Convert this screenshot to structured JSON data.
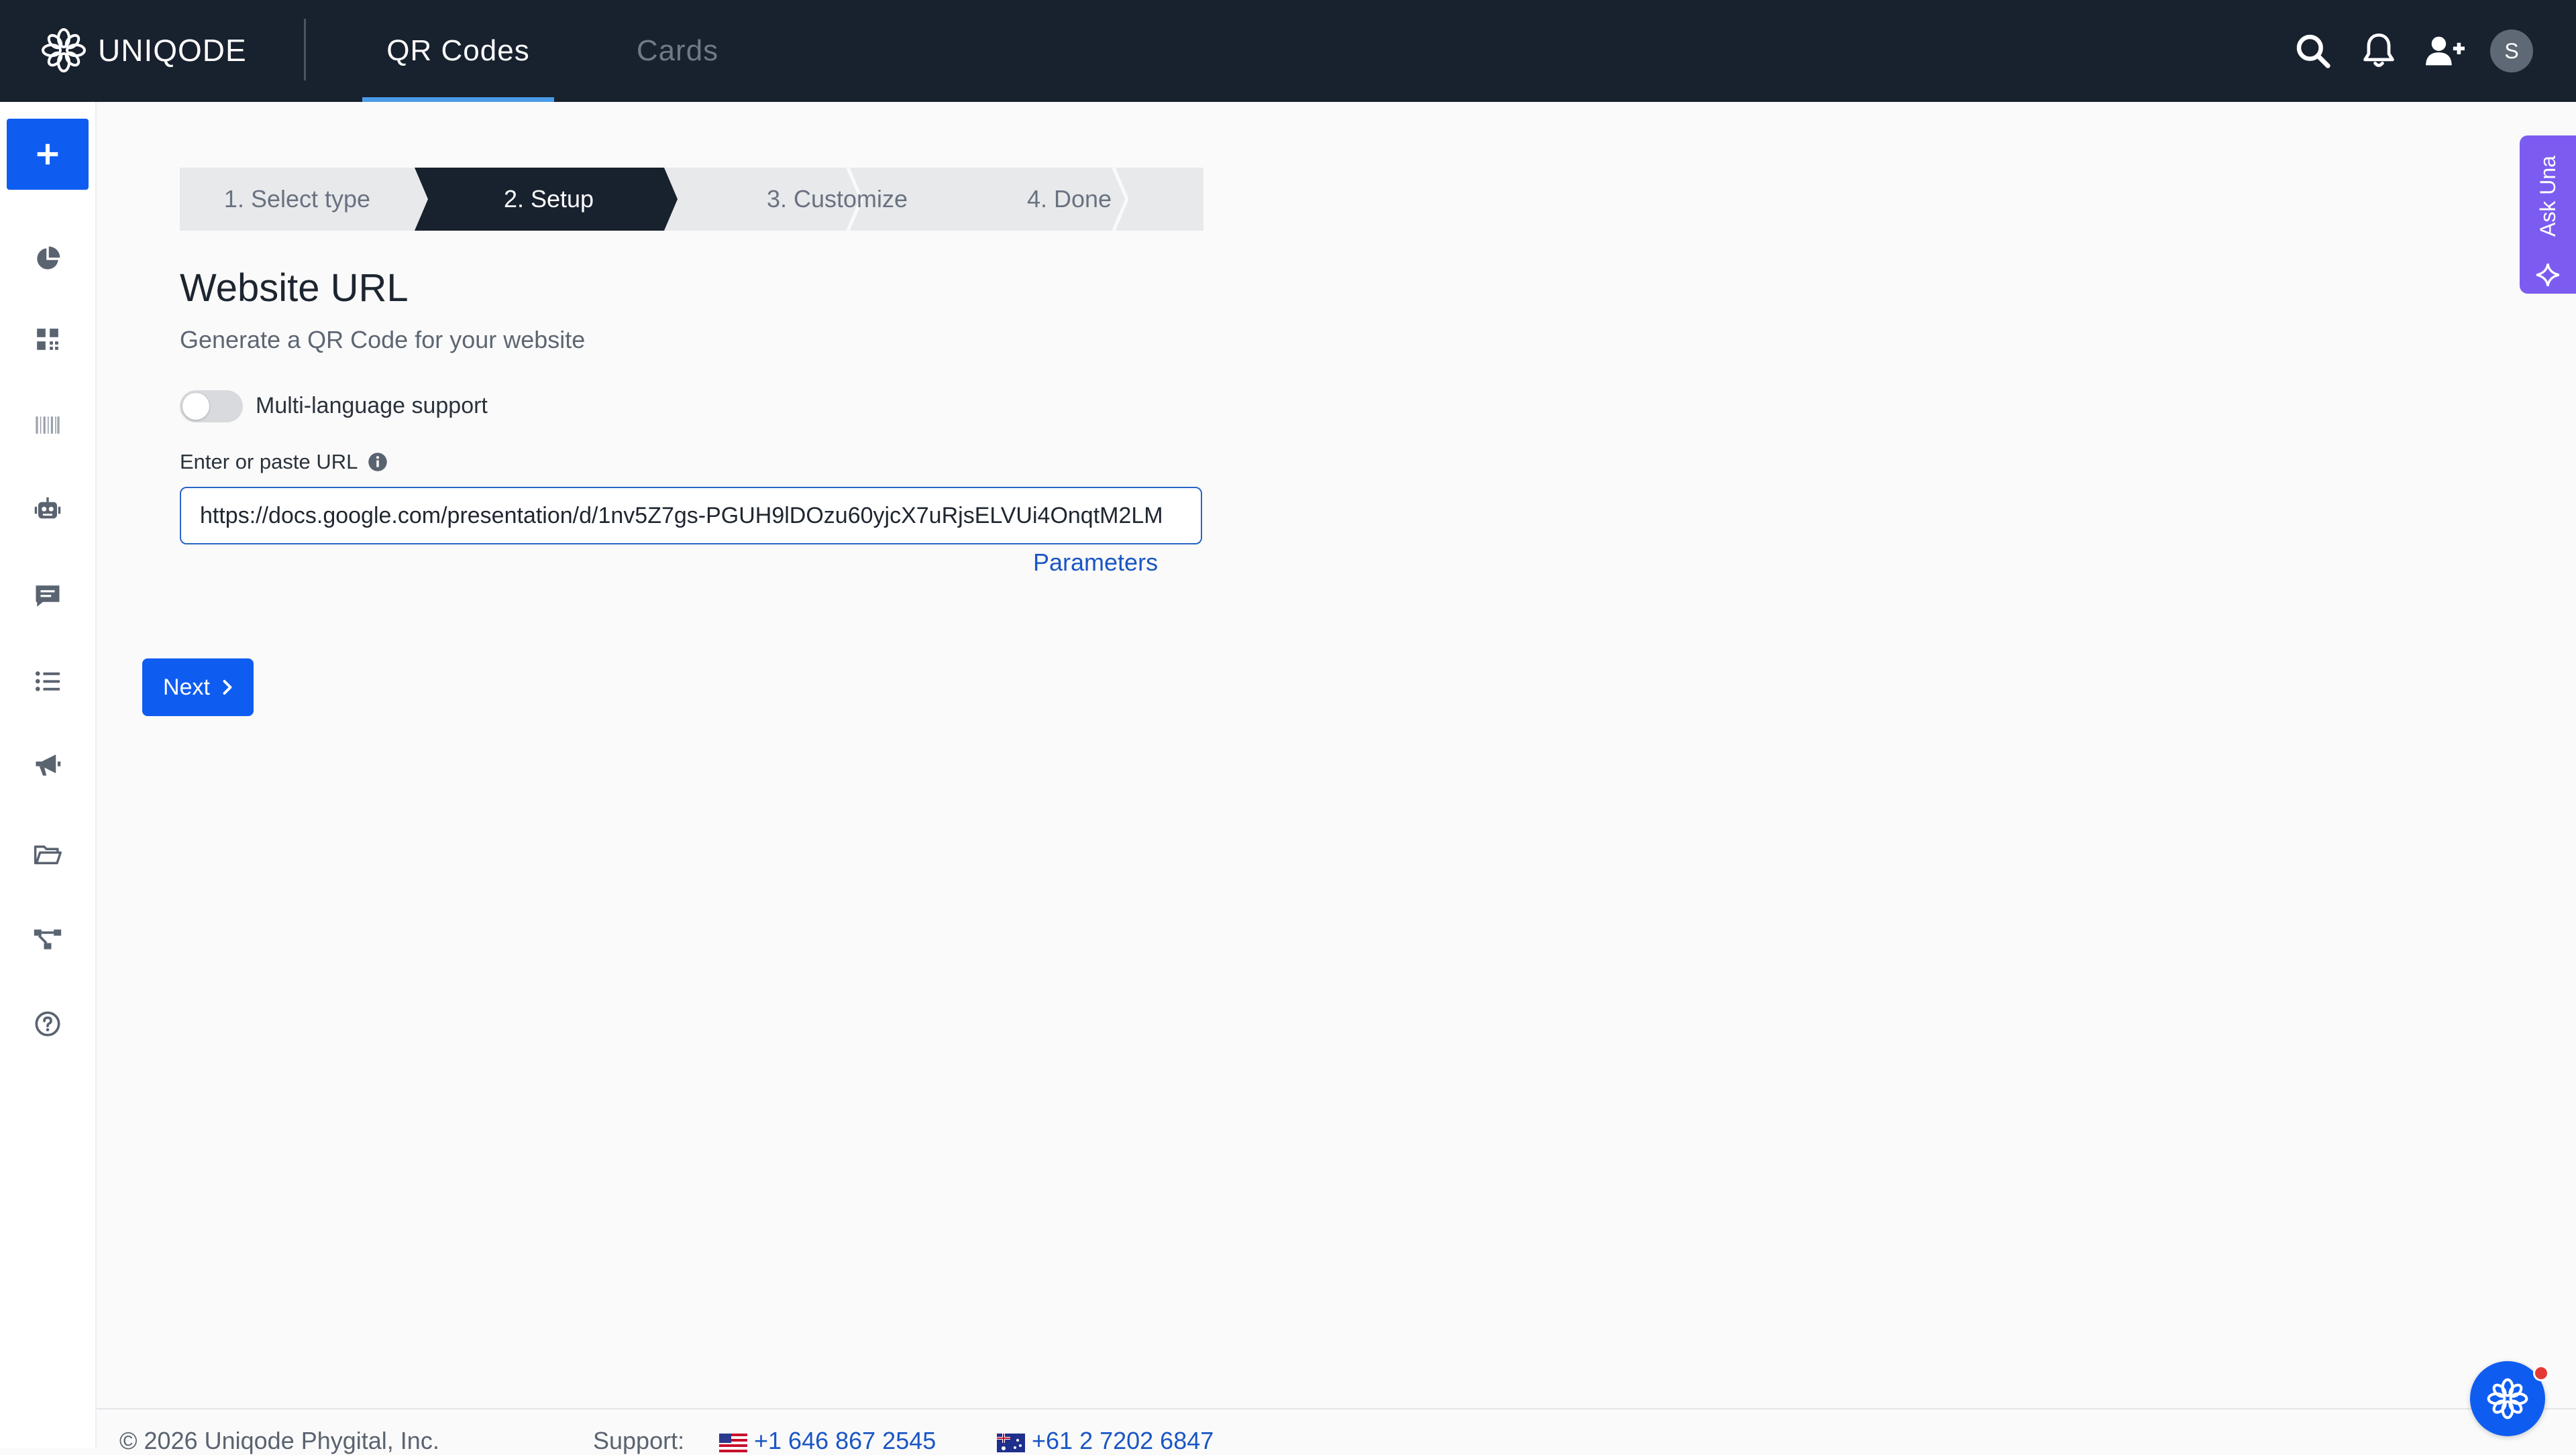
{
  "brand": {
    "name": "UNIQODE"
  },
  "nav": {
    "tabs": [
      {
        "label": "QR Codes",
        "active": true
      },
      {
        "label": "Cards",
        "active": false
      }
    ]
  },
  "topbar_icons": [
    "search-icon",
    "bell-icon",
    "add-user-icon"
  ],
  "user": {
    "initial": "S"
  },
  "sidebar": {
    "items": [
      {
        "icon": "plus-icon",
        "name": "create"
      },
      {
        "icon": "pie-chart-icon",
        "name": "analytics"
      },
      {
        "icon": "qr-code-icon",
        "name": "qr-codes"
      },
      {
        "icon": "barcode-icon",
        "name": "barcodes"
      },
      {
        "icon": "robot-icon",
        "name": "automation"
      },
      {
        "icon": "message-icon",
        "name": "messages"
      },
      {
        "icon": "list-icon",
        "name": "lists"
      },
      {
        "icon": "megaphone-icon",
        "name": "campaigns"
      },
      {
        "icon": "folder-icon",
        "name": "folders"
      },
      {
        "icon": "hierarchy-icon",
        "name": "hierarchy"
      },
      {
        "icon": "help-icon",
        "name": "help"
      }
    ]
  },
  "stepper": {
    "steps": [
      {
        "label": "1. Select type"
      },
      {
        "label": "2. Setup"
      },
      {
        "label": "3. Customize"
      },
      {
        "label": "4. Done"
      }
    ],
    "current_index": 1
  },
  "form": {
    "title": "Website URL",
    "subtitle": "Generate a QR Code for your website",
    "multilang_label": "Multi-language support",
    "multilang_enabled": false,
    "url_label": "Enter or paste URL",
    "url_value": "https://docs.google.com/presentation/d/1nv5Z7gs-PGUH9lDOzu60yjcX7uRjsELVUi4OnqtM2LM",
    "parameters_link": "Parameters"
  },
  "actions": {
    "next_label": "Next"
  },
  "ask_una": {
    "label": "Ask Una"
  },
  "footer": {
    "copyright": "© 2026 Uniqode Phygital, Inc.",
    "support_label": "Support:",
    "phone_us": "+1 646 867 2545",
    "phone_au": "+61 2 7202 6847"
  },
  "colors": {
    "topbar": "#18212e",
    "primary": "#0f5cf1",
    "accent_tab": "#4a9be8",
    "ask_una": "#7c5cf0",
    "link": "#1a56c4"
  }
}
